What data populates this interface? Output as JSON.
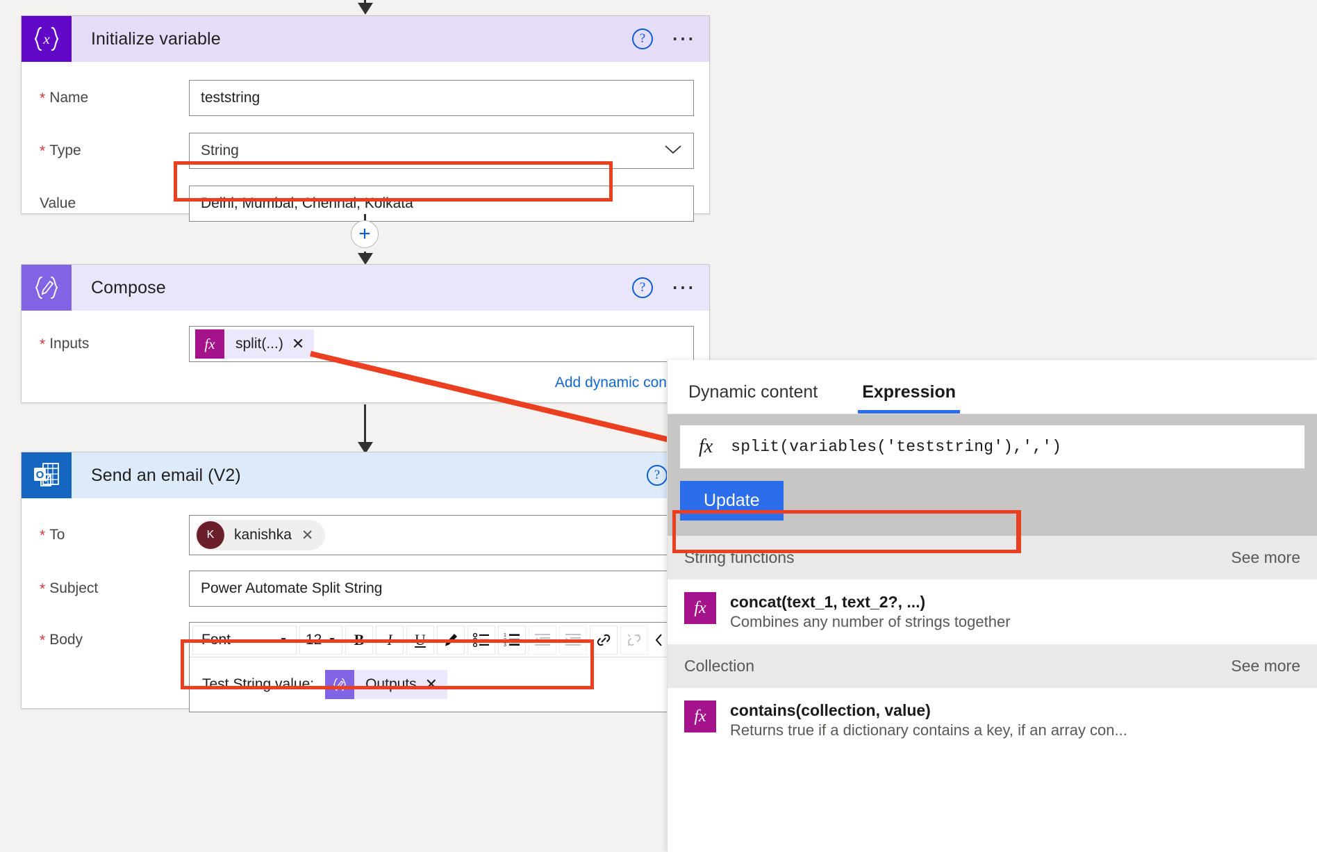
{
  "flow": {
    "initialize_variable": {
      "title": "Initialize variable",
      "icon": "variable-braces-x-icon",
      "help_icon": "help-icon",
      "menu_icon": "more-options-icon",
      "fields": [
        {
          "label": "Name",
          "required": true,
          "value": "teststring",
          "kind": "text"
        },
        {
          "label": "Type",
          "required": true,
          "value": "String",
          "kind": "select"
        },
        {
          "label": "Value",
          "required": false,
          "value": "Delhi, Mumbai, Chennai, Kolkata",
          "kind": "text"
        }
      ]
    },
    "compose": {
      "title": "Compose",
      "icon": "compose-braces-pencil-icon",
      "help_icon": "help-icon",
      "menu_icon": "more-options-icon",
      "inputs_label": "Inputs",
      "inputs_token": "split(...)",
      "inputs_token_icon": "fx-icon",
      "token_remove": "✕",
      "add_dynamic_content": "Add dynamic content"
    },
    "send_email": {
      "title": "Send an email (V2)",
      "icon": "outlook-icon",
      "help_icon": "help-icon",
      "to_label": "To",
      "to_person": "kanishka",
      "to_person_initial": "K",
      "to_person_remove": "✕",
      "subject_label": "Subject",
      "subject_value": "Power Automate Split String",
      "body_label": "Body",
      "body_text": "Test String value:",
      "body_token": "Outputs",
      "body_token_icon": "compose-braces-pencil-icon",
      "body_token_remove": "✕",
      "toolbar": {
        "font_name": "Font",
        "font_size": "12",
        "bold": "B",
        "italic": "I",
        "underline": "U",
        "highlight_icon": "pen-highlight-icon",
        "bulleted_list_icon": "bulleted-list-icon",
        "numbered_list_icon": "numbered-list-icon",
        "decrease_indent_icon": "decrease-indent-icon",
        "increase_indent_icon": "increase-indent-icon",
        "insert_link_icon": "link-icon",
        "remove_link_icon": "unlink-icon",
        "code_view_icon": "code-view-icon"
      }
    },
    "add_step_plus": "+"
  },
  "panel": {
    "tabs": [
      {
        "label": "Dynamic content",
        "active": false
      },
      {
        "label": "Expression",
        "active": true
      }
    ],
    "expression": {
      "fx_glyph": "fx",
      "value": "split(variables('teststring'),',')",
      "update_label": "Update"
    },
    "sections": [
      {
        "title": "String functions",
        "see_more": "See more",
        "functions": [
          {
            "icon": "fx-icon",
            "signature": "concat(text_1, text_2?, ...)",
            "description": "Combines any number of strings together"
          }
        ]
      },
      {
        "title": "Collection",
        "see_more": "See more",
        "functions": [
          {
            "icon": "fx-icon",
            "signature": "contains(collection, value)",
            "description": "Returns true if a dictionary contains a key, if an array con..."
          }
        ]
      }
    ]
  },
  "annotations": {
    "highlight_color": "#ea3f21",
    "boxes": [
      "value-field-highlight",
      "expression-input-highlight",
      "body-content-highlight"
    ],
    "connector": "token-to-expression-pointer"
  }
}
